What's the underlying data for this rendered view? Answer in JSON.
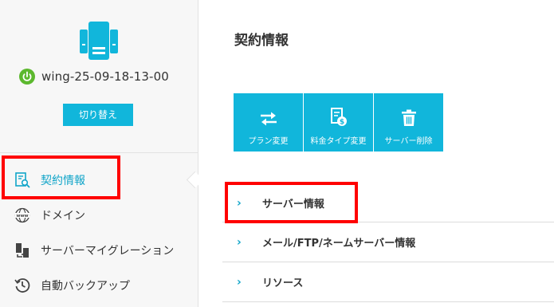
{
  "server": {
    "name": "wing-25-09-18-13-00",
    "switch_label": "切り替え"
  },
  "nav": {
    "items": [
      {
        "label": "契約情報",
        "icon": "contract-search-icon",
        "active": true
      },
      {
        "label": "ドメイン",
        "icon": "www-globe-icon"
      },
      {
        "label": "サーバーマイグレーション",
        "icon": "migration-icon"
      },
      {
        "label": "自動バックアップ",
        "icon": "backup-clock-icon"
      }
    ]
  },
  "main": {
    "title": "契約情報",
    "actions": [
      {
        "label": "プラン変更",
        "icon": "swap-arrows-icon"
      },
      {
        "label": "料金タイプ変更",
        "icon": "invoice-dollar-icon"
      },
      {
        "label": "サーバー削除",
        "icon": "trash-icon"
      }
    ],
    "sections": [
      {
        "label": "サーバー情報"
      },
      {
        "label": "メール/FTP/ネームサーバー情報"
      },
      {
        "label": "リソース"
      }
    ]
  },
  "colors": {
    "accent": "#11b6db",
    "power_green": "#5cb82e",
    "highlight": "#ff0000"
  }
}
